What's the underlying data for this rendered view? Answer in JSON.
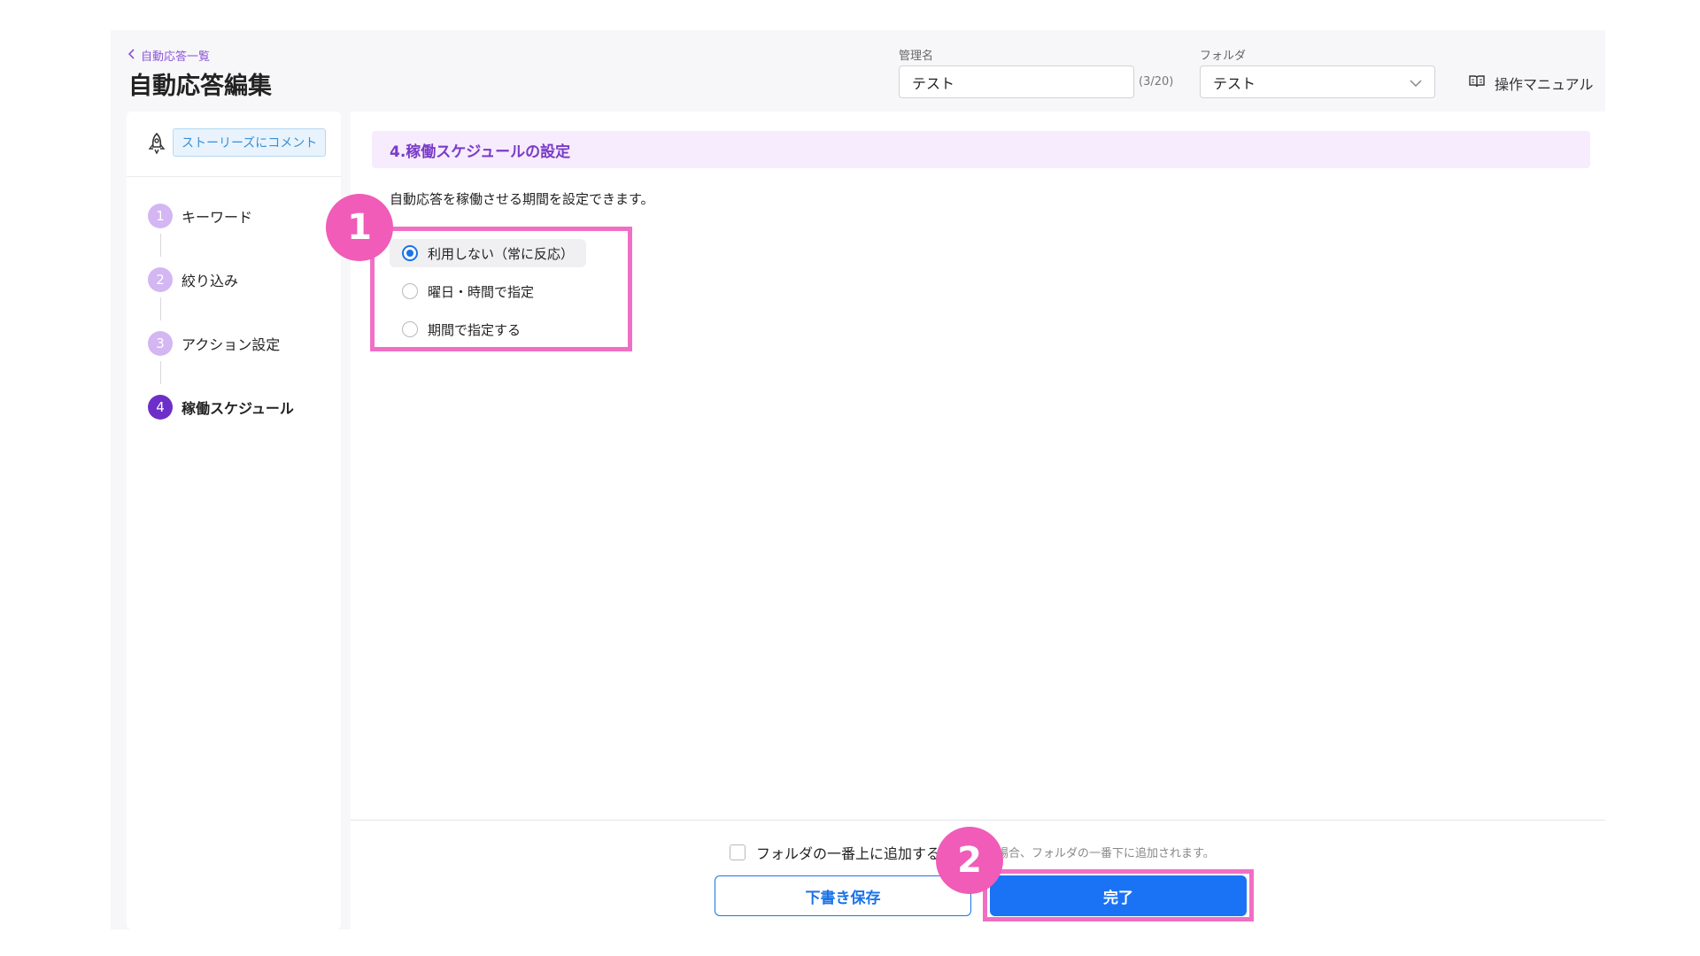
{
  "header": {
    "back_link": "自動応答一覧",
    "title": "自動応答編集",
    "name_label": "管理名",
    "name_value": "テスト",
    "name_counter": "(3/20)",
    "folder_label": "フォルダ",
    "folder_value": "テスト",
    "manual_label": "操作マニュアル"
  },
  "sidebar": {
    "trigger_badge": "ストーリーズにコメント",
    "steps": [
      {
        "num": "1",
        "label": "キーワード"
      },
      {
        "num": "2",
        "label": "絞り込み"
      },
      {
        "num": "3",
        "label": "アクション設定"
      },
      {
        "num": "4",
        "label": "稼働スケジュール"
      }
    ]
  },
  "main": {
    "section_title": "4.稼働スケジュールの設定",
    "description": "自動応答を稼働させる期間を設定できます。",
    "options": [
      {
        "label": "利用しない（常に反応）",
        "selected": true
      },
      {
        "label": "曜日・時間で指定",
        "selected": false
      },
      {
        "label": "期間で指定する",
        "selected": false
      }
    ]
  },
  "footer": {
    "checkbox_label": "フォルダの一番上に追加する",
    "hint": "場合、フォルダの一番下に追加されます。",
    "draft_button": "下書き保存",
    "done_button": "完了"
  },
  "annotations": {
    "callout_1": "1",
    "callout_2": "2"
  },
  "colors": {
    "accent_purple": "#7a3bc8",
    "primary_blue": "#1a73f5",
    "highlight_pink": "#f06fc4"
  }
}
